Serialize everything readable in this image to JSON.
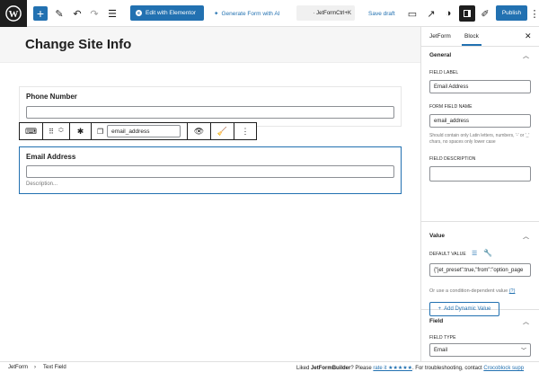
{
  "topbar": {
    "elementor_button": "Edit with Elementor",
    "generate_form": "Generate Form with AI",
    "command_bar": "· JetFormCtrl+K",
    "save_draft": "Save draft",
    "publish": "Publish"
  },
  "editor": {
    "page_title": "Change Site Info",
    "phone_field": {
      "label": "Phone Number"
    },
    "toolbar": {
      "field_name": "email_address"
    },
    "email_field": {
      "label": "Email Address",
      "description": "Description..."
    }
  },
  "sidebar": {
    "tabs": [
      "JetForm",
      "Block"
    ],
    "active_tab": "Block",
    "general": {
      "heading": "General",
      "field_label_title": "FIELD LABEL",
      "field_label_value": "Email Address",
      "field_name_title": "FORM FIELD NAME",
      "field_name_value": "email_address",
      "field_name_help": "Should contain only Latin letters, numbers, '-' or '_' chars, no spaces only lower case",
      "field_description_title": "FIELD DESCRIPTION",
      "field_description_value": ""
    },
    "value": {
      "heading": "Value",
      "default_value_title": "DEFAULT VALUE",
      "default_value": "{\"jet_preset\":true,\"from\":\"option_page",
      "condition_text": "Or use a condition-dependent value",
      "condition_link": "(?)",
      "dynamic_button": "Add Dynamic Value"
    },
    "field": {
      "heading": "Field",
      "field_type_title": "FIELD TYPE",
      "field_type_value": "Email"
    }
  },
  "footer": {
    "breadcrumbs": [
      "JetForm",
      "Text Field"
    ],
    "liked_prefix": "Liked ",
    "liked_brand": "JetFormBuilder",
    "liked_middle": "? Please ",
    "rate_link": "rate it ★★★★★",
    "liked_suffix": ". For troubleshooting, contact ",
    "support_link": "Crocoblock supp"
  },
  "colors": {
    "accent": "#2271b1",
    "dark": "#1e1e1e"
  }
}
